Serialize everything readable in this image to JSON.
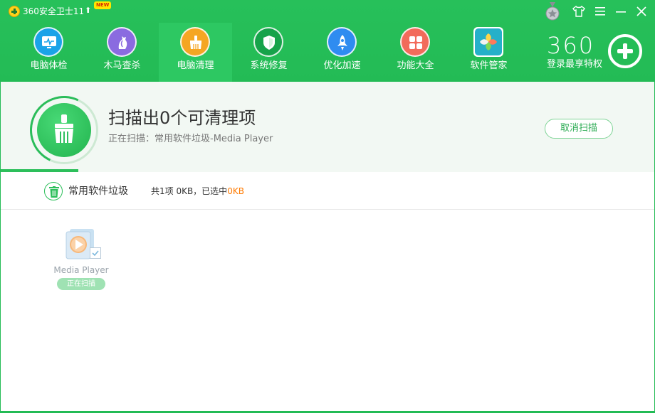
{
  "titlebar": {
    "app_title": "360安全卫士11",
    "new_badge": "NEW",
    "update_arrow": "up-arrow-icon",
    "window_controls": [
      "medal-icon",
      "skin-shirt-icon",
      "menu-icon",
      "minimize-icon",
      "close-icon"
    ]
  },
  "nav": {
    "items": [
      {
        "label": "电脑体检",
        "icon": "monitor-icon",
        "color": "#1aa3e8"
      },
      {
        "label": "木马查杀",
        "icon": "horse-icon",
        "color": "#8a6be0"
      },
      {
        "label": "电脑清理",
        "icon": "broom-icon",
        "color": "#f5a623",
        "active": true
      },
      {
        "label": "系统修复",
        "icon": "shield-icon",
        "color": "#16a34a"
      },
      {
        "label": "优化加速",
        "icon": "rocket-icon",
        "color": "#2f8cf0"
      },
      {
        "label": "功能大全",
        "icon": "grid-icon",
        "color": "#f26b5b"
      },
      {
        "label": "软件管家",
        "icon": "apps-flower-icon",
        "color": "#25b0c9"
      }
    ],
    "brand": "360",
    "vip_label": "登录最享特权"
  },
  "status": {
    "title": "扫描出0个可清理项",
    "subtitle": "正在扫描：常用软件垃圾-Media Player",
    "cancel_label": "取消扫描",
    "progress": 0.12
  },
  "category": {
    "name": "常用软件垃圾",
    "summary_prefix": "共1项 0KB，已选中",
    "selected_size": "0KB"
  },
  "items": [
    {
      "name": "Media Player",
      "status": "正在扫描",
      "checked": true
    }
  ],
  "colors": {
    "brand_green": "#23bb55",
    "accent_orange": "#ff7a00"
  }
}
